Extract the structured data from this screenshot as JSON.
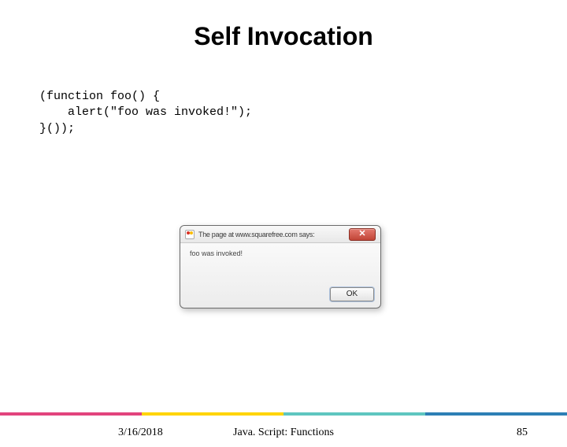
{
  "title": "Self Invocation",
  "code": "(function foo() {\n    alert(\"foo was invoked!\");\n}());",
  "dialog": {
    "title_text": "The page at www.squarefree.com says:",
    "message": "foo was invoked!",
    "close_glyph": "✕",
    "ok_label": "OK"
  },
  "footer": {
    "date": "3/16/2018",
    "center": "Java. Script: Functions",
    "page": "85"
  }
}
